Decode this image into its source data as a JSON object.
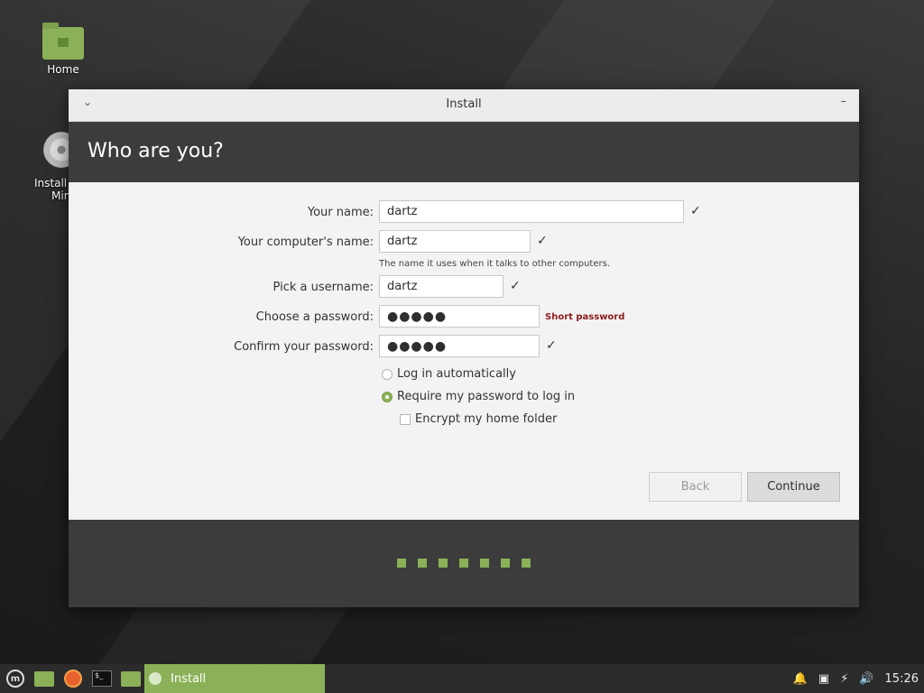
{
  "desktop": {
    "home_label": "Home",
    "install_label_line1": "Install L",
    "install_label_line2": "Min"
  },
  "window": {
    "title": "Install",
    "menu_glyph": "⌄",
    "minimize_glyph": "–",
    "heading": "Who are you?"
  },
  "form": {
    "your_name_label": "Your name:",
    "your_name_value": "dartz",
    "computer_name_label": "Your computer's name:",
    "computer_name_value": "dartz",
    "computer_name_hint": "The name it uses when it talks to other computers.",
    "username_label": "Pick a username:",
    "username_value": "dartz",
    "password_label": "Choose a password:",
    "password_value": "●●●●●",
    "password_warning": "Short password",
    "confirm_label": "Confirm your password:",
    "confirm_value": "●●●●●",
    "check_glyph": "✓",
    "login_auto_label": "Log in automatically",
    "login_auto_selected": false,
    "require_password_label": "Require my password to log in",
    "require_password_selected": true,
    "encrypt_label": "Encrypt my home folder",
    "encrypt_checked": false
  },
  "buttons": {
    "back": "Back",
    "continue": "Continue"
  },
  "progress": {
    "total_steps": 7
  },
  "taskbar": {
    "active_window": "Install",
    "terminal_glyph": "$_",
    "clock": "15:26",
    "accent": "#8bb158"
  }
}
